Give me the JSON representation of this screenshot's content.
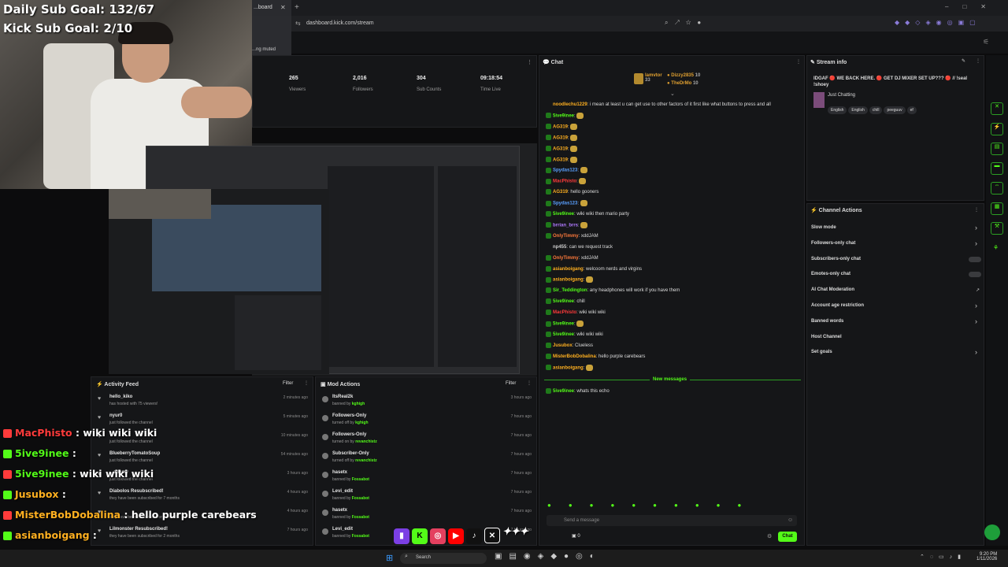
{
  "overlay": {
    "daily_goal": "Daily Sub Goal: 132/67",
    "kick_goal": "Kick Sub Goal: 2/10",
    "chat": [
      {
        "user": "MacPhisto",
        "msg": ": wiki wiki wiki",
        "color": "#ff3b3b"
      },
      {
        "user": "5ive9inee",
        "msg": ":",
        "color": "#53fc18"
      },
      {
        "user": "5ive9inee",
        "msg": ": wiki wiki wiki",
        "color": "#53fc18"
      },
      {
        "user": "Jusubox",
        "msg": ":",
        "color": "#ffb020"
      },
      {
        "user": "MisterBobDobalina",
        "msg": ": hello purple carebears",
        "color": "#ffb020"
      },
      {
        "user": "asianboigang",
        "msg": ":",
        "color": "#ffb020"
      },
      {
        "user": "5ive9inee",
        "msg": ": whats this echo",
        "color": "#53fc18"
      }
    ]
  },
  "browser": {
    "tab_label": "...board",
    "url": "dashboard.kick.com/stream",
    "dropdown_line1": "...ng muted",
    "dropdown_line2": "8"
  },
  "stats": [
    {
      "value": "265",
      "label": "Viewers"
    },
    {
      "value": "2,016",
      "label": "Followers"
    },
    {
      "value": "304",
      "label": "Sub Counts"
    },
    {
      "value": "09:18:54",
      "label": "Time Live"
    }
  ],
  "activity": {
    "title": "Activity Feed",
    "filter": "Filter",
    "rows": [
      {
        "title": "hello_kiko",
        "sub": "has hosted with 75 viewers!",
        "time": "2 minutes ago"
      },
      {
        "title": "nyur0",
        "sub": "just followed the channel",
        "time": "5 minutes ago"
      },
      {
        "title": "",
        "sub": "just followed the channel",
        "time": "10 minutes ago"
      },
      {
        "title": "BlueberryTomatoSoup",
        "sub": "just followed the channel",
        "time": "54 minutes ago"
      },
      {
        "title": "...ademy",
        "sub": "just followed the channel",
        "time": "3 hours ago"
      },
      {
        "title": "Diabolos Resubscribed!",
        "sub": "they have been subscribed for 7 months",
        "time": "4 hours ago"
      },
      {
        "title": "",
        "sub": "they have been subscribed for 7 months",
        "time": "4 hours ago"
      },
      {
        "title": "Lilmonster Resubscribed!",
        "sub": "they have been subscribed for 2 months",
        "time": "7 hours ago"
      }
    ]
  },
  "mod": {
    "title": "Mod Actions",
    "filter": "Filter",
    "rows": [
      {
        "title": "ItsReal2k",
        "by": "banned by",
        "who": "kghigh",
        "time": "3 hours ago"
      },
      {
        "title": "Followers-Only",
        "by": "turned off by",
        "who": "kghigh",
        "time": "7 hours ago"
      },
      {
        "title": "Followers-Only",
        "by": "turned on by",
        "who": "revanchistz",
        "time": "7 hours ago"
      },
      {
        "title": "Subscriber-Only",
        "by": "turned off by",
        "who": "revanchistz",
        "time": "7 hours ago"
      },
      {
        "title": "hasetx",
        "by": "banned by",
        "who": "Fossabot",
        "time": "7 hours ago"
      },
      {
        "title": "Levi_edit",
        "by": "banned by",
        "who": "Fossabot",
        "time": "7 hours ago"
      },
      {
        "title": "hasetx",
        "by": "banned by",
        "who": "Fossabot",
        "time": "7 hours ago"
      },
      {
        "title": "Levi_edit",
        "by": "banned by",
        "who": "Fossabot",
        "time": "7 hours ago"
      }
    ]
  },
  "chat": {
    "title": "Chat",
    "top_gifters": [
      {
        "name": "lamvtor",
        "count": "33"
      },
      {
        "name": "Dizzy2835",
        "count": "10"
      },
      {
        "name": "TheDrMo",
        "count": "10"
      }
    ],
    "messages": [
      {
        "user": "noodlechu1229",
        "msg": "i mean at least u can get use to other factors of it first like what buttons to press and all",
        "color": "#ffb020"
      },
      {
        "user": "5ive9inee",
        "msg": "",
        "color": "#53fc18"
      },
      {
        "user": "AG319",
        "msg": "",
        "color": "#ffb020"
      },
      {
        "user": "AG319",
        "msg": "",
        "color": "#ffb020"
      },
      {
        "user": "AG319",
        "msg": "",
        "color": "#ffb020"
      },
      {
        "user": "AG319",
        "msg": "",
        "color": "#ffb020"
      },
      {
        "user": "Spydas123",
        "msg": "",
        "color": "#5aa0ff"
      },
      {
        "user": "MacPhisto",
        "msg": "",
        "color": "#ff3b3b"
      },
      {
        "user": "AG319",
        "msg": "hello gooners",
        "color": "#ffb020"
      },
      {
        "user": "Spydas123",
        "msg": "",
        "color": "#5aa0ff"
      },
      {
        "user": "5ive9inee",
        "msg": "wiki wiki then mario party",
        "color": "#53fc18"
      },
      {
        "user": "brrian_brrs",
        "msg": "",
        "color": "#b07aff"
      },
      {
        "user": "OnlyTimmy",
        "msg": "xddJAM",
        "color": "#ff7a3b"
      },
      {
        "user": "np455",
        "msg": "can we request track",
        "color": "#cfcfcf"
      },
      {
        "user": "OnlyTimmy",
        "msg": "xddJAM",
        "color": "#ff7a3b"
      },
      {
        "user": "asianboigang",
        "msg": "welcoom nerds and virgins",
        "color": "#ffb020"
      },
      {
        "user": "asianboigang",
        "msg": "",
        "color": "#ffb020"
      },
      {
        "user": "Sir_Teddington",
        "msg": "any headphones will work if you have them",
        "color": "#53fc18"
      },
      {
        "user": "5ive9inee",
        "msg": "chill",
        "color": "#53fc18"
      },
      {
        "user": "MacPhisto",
        "msg": "wiki wiki wiki",
        "color": "#ff3b3b"
      },
      {
        "user": "5ive9inee",
        "msg": "",
        "color": "#53fc18"
      },
      {
        "user": "5ive9inee",
        "msg": "wiki wiki wiki",
        "color": "#53fc18"
      },
      {
        "user": "Jusubox",
        "msg": "Clueless",
        "color": "#ffb020"
      },
      {
        "user": "MisterBobDobalina",
        "msg": "hello purple carebears",
        "color": "#ffb020"
      },
      {
        "user": "asianboigang",
        "msg": "",
        "color": "#ffb020"
      }
    ],
    "new_messages": "New messages",
    "last": {
      "user": "5ive9inee",
      "msg": "whats this echo",
      "color": "#53fc18"
    },
    "placeholder": "Send a message",
    "points": "0",
    "send_label": "Chat"
  },
  "stream_info": {
    "title": "Stream info",
    "stream_title": "IDGAF 🔴 WE BACK HERE. 🔴 GET DJ MIXER SET UP??? 🔴 // !seal !shoey",
    "category": "Just Chatting",
    "tags": [
      "English",
      "English",
      "chill",
      "peeguuv",
      "ef"
    ]
  },
  "actions": {
    "title": "Channel Actions",
    "items": [
      {
        "label": "Slow mode",
        "kind": "chevron"
      },
      {
        "label": "Followers-only chat",
        "kind": "chevron"
      },
      {
        "label": "Subscribers-only chat",
        "kind": "toggle"
      },
      {
        "label": "Emotes-only chat",
        "kind": "toggle"
      },
      {
        "label": "AI Chat Moderation",
        "kind": "link"
      },
      {
        "label": "Account age restriction",
        "kind": "chevron"
      },
      {
        "label": "Banned words",
        "kind": "chevron"
      },
      {
        "label": "Host Channel",
        "kind": "none"
      },
      {
        "label": "Set goals",
        "kind": "chevron"
      }
    ]
  },
  "taskbar": {
    "search": "Search",
    "time": "9:20 PM",
    "date": "1/11/2026"
  },
  "colors": {
    "kick_green": "#53fc18",
    "panel": "#151618",
    "bg": "#0c0c0d"
  }
}
